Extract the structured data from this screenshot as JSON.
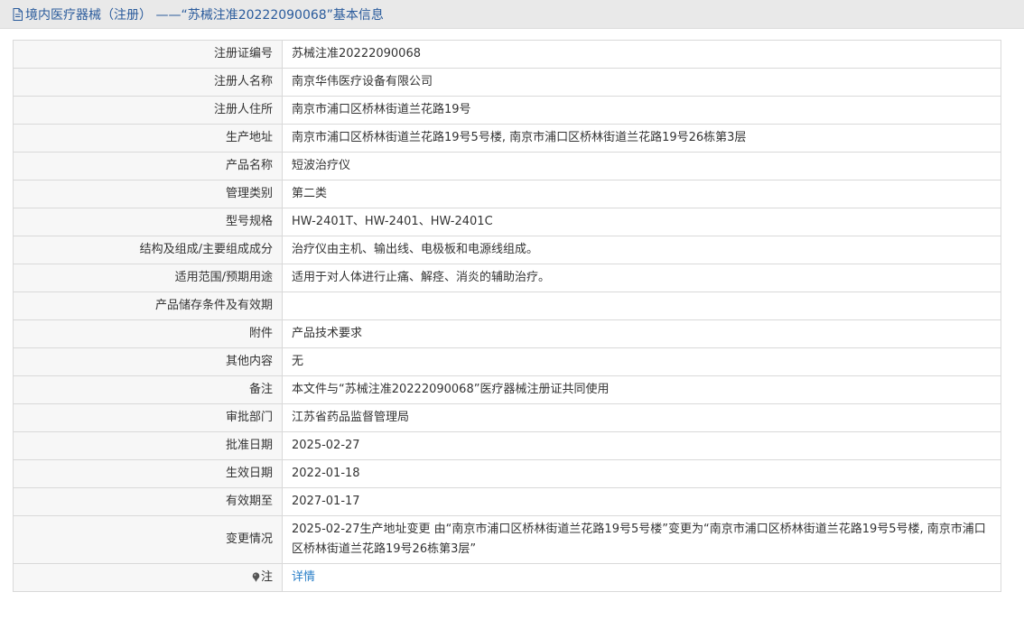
{
  "header": {
    "title": "境内医疗器械（注册） ——“苏械注准20222090068”基本信息"
  },
  "rows": [
    {
      "label": "注册证编号",
      "value": "苏械注准20222090068"
    },
    {
      "label": "注册人名称",
      "value": "南京华伟医疗设备有限公司"
    },
    {
      "label": "注册人住所",
      "value": "南京市浦口区桥林街道兰花路19号"
    },
    {
      "label": "生产地址",
      "value": "南京市浦口区桥林街道兰花路19号5号楼, 南京市浦口区桥林街道兰花路19号26栋第3层"
    },
    {
      "label": "产品名称",
      "value": "短波治疗仪"
    },
    {
      "label": "管理类别",
      "value": "第二类"
    },
    {
      "label": "型号规格",
      "value": "HW-2401T、HW-2401、HW-2401C"
    },
    {
      "label": "结构及组成/主要组成成分",
      "value": "治疗仪由主机、输出线、电极板和电源线组成。"
    },
    {
      "label": "适用范围/预期用途",
      "value": "适用于对人体进行止痛、解痉、消炎的辅助治疗。"
    },
    {
      "label": "产品储存条件及有效期",
      "value": ""
    },
    {
      "label": "附件",
      "value": "产品技术要求"
    },
    {
      "label": "其他内容",
      "value": "无"
    },
    {
      "label": "备注",
      "value": "本文件与“苏械注准20222090068”医疗器械注册证共同使用"
    },
    {
      "label": "审批部门",
      "value": "江苏省药品监督管理局"
    },
    {
      "label": "批准日期",
      "value": "2025-02-27"
    },
    {
      "label": "生效日期",
      "value": "2022-01-18"
    },
    {
      "label": "有效期至",
      "value": "2027-01-17"
    },
    {
      "label": "变更情况",
      "value": "2025-02-27生产地址变更 由“南京市浦口区桥林街道兰花路19号5号楼”变更为“南京市浦口区桥林街道兰花路19号5号楼, 南京市浦口区桥林街道兰花路19号26栋第3层”"
    }
  ],
  "note": {
    "label": "注",
    "link_text": "详情",
    "icon": "pin-icon"
  }
}
